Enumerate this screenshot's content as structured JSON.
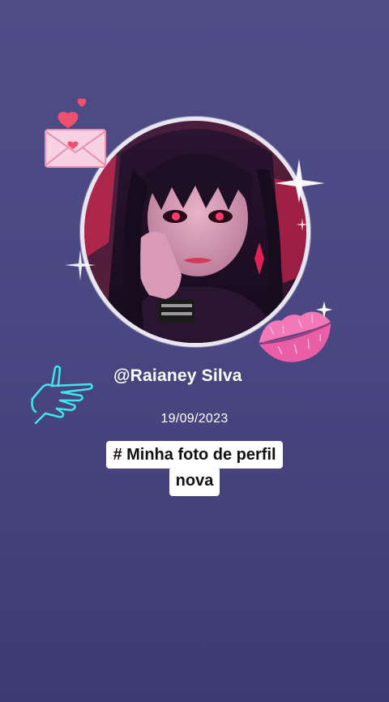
{
  "profile": {
    "username": "@Raianey Silva",
    "date": "19/09/2023",
    "caption_line1": "# Minha foto de perfil",
    "caption_line2": "nova"
  },
  "stickers": {
    "envelope": "love-letter-icon",
    "lips": "kiss-lips-icon",
    "hand": "pointing-hand-icon",
    "sparkle": "sparkle-icon"
  },
  "colors": {
    "background_top": "#4f4d86",
    "background_bottom": "#3d3a73",
    "text": "#ffffff",
    "caption_bg": "#ffffff",
    "lips": "#f06ab0",
    "hand_outline": "#3ee6ea",
    "envelope": "#f4b6cf",
    "heart": "#f0506e"
  }
}
